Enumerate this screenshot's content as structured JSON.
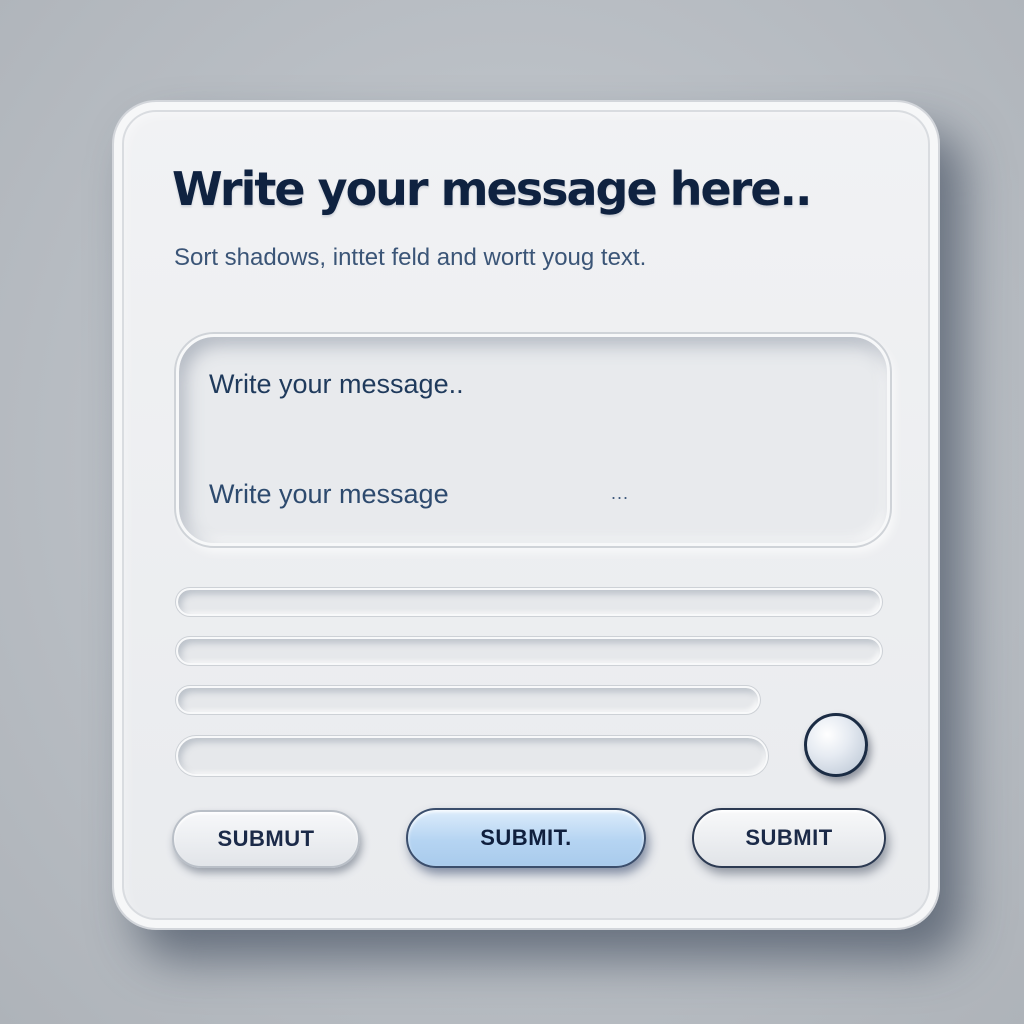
{
  "form": {
    "title": "Write your message here..",
    "subtitle": "Sort shadows, inttet feld and wortt youg text.",
    "message_field": {
      "line1": "Write your message..",
      "line2": "Write your message",
      "trailing": "..."
    },
    "buttons": {
      "left_label": "SUBMUT",
      "center_label": "SUBMIT.",
      "right_label": "SUBMIT"
    }
  },
  "colors": {
    "title": "#0f2240",
    "accent_button": "#b5d4f2",
    "background": "#b9bec4"
  }
}
